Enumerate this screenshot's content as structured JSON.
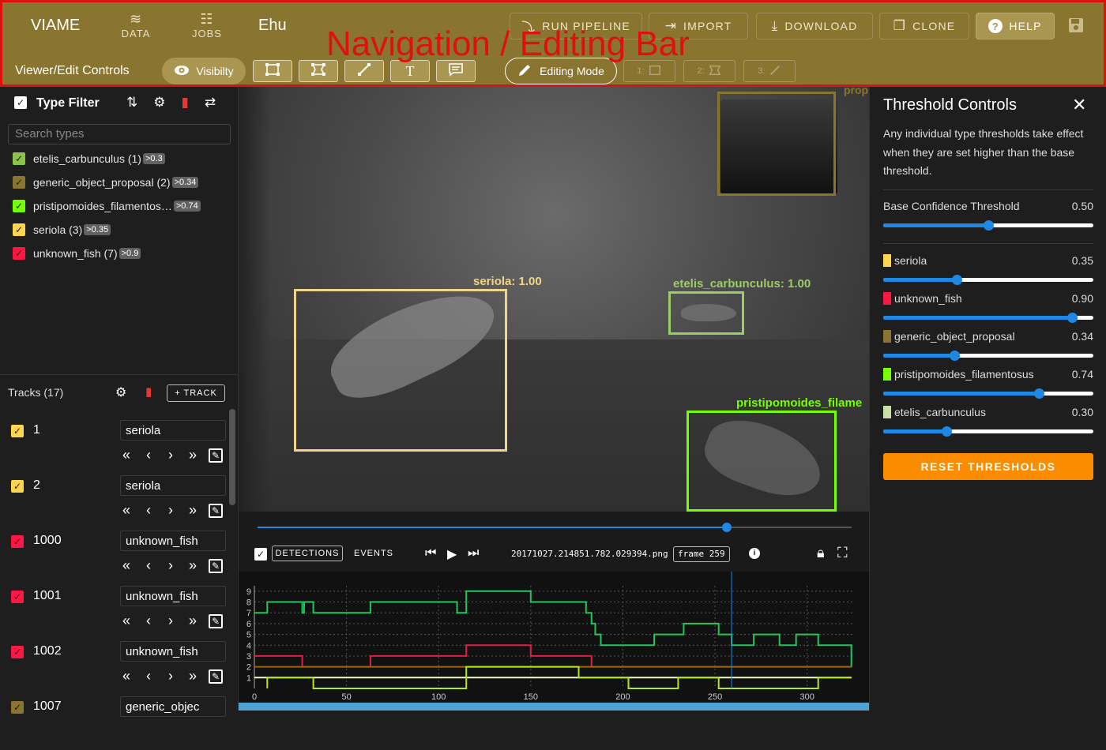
{
  "header": {
    "brand": "VIAME",
    "nav": [
      {
        "label": "DATA",
        "icon": "database-icon",
        "glyph": "≋"
      },
      {
        "label": "JOBS",
        "icon": "checklist-icon",
        "glyph": "☷"
      }
    ],
    "dataset_name": "Ehu",
    "actions": [
      {
        "label": "RUN PIPELINE",
        "icon": "pipeline-icon",
        "glyph": "⤵"
      },
      {
        "label": "IMPORT",
        "icon": "import-icon",
        "glyph": "⇥"
      },
      {
        "label": "DOWNLOAD",
        "icon": "download-icon",
        "glyph": "⤓"
      },
      {
        "label": "CLONE",
        "icon": "clone-icon",
        "glyph": "❐"
      },
      {
        "label": "HELP",
        "icon": "help-icon",
        "glyph": "?"
      }
    ],
    "subtitle": "Viewer/Edit Controls",
    "visibility_label": "Visibilty",
    "editing_mode_label": "Editing Mode",
    "overlay_annotation": "Navigation / Editing Bar",
    "text_tool_glyph": "T",
    "disabled_tools": [
      "1:",
      "2:",
      "3:"
    ],
    "accent_color": "#8a7530",
    "annotation_color": "#e01010"
  },
  "type_filter": {
    "title": "Type Filter",
    "search_placeholder": "Search types",
    "types": [
      {
        "name": "etelis_carbunculus (1)",
        "threshold": ">0.3",
        "color": "#8bc34a"
      },
      {
        "name": "generic_object_proposal (2)",
        "threshold": ">0.34",
        "color": "#8a7530"
      },
      {
        "name": "pristipomoides_filamentos…",
        "threshold": ">0.74",
        "color": "#76ff03"
      },
      {
        "name": "seriola (3)",
        "threshold": ">0.35",
        "color": "#ffd54f"
      },
      {
        "name": "unknown_fish (7)",
        "threshold": ">0.9",
        "color": "#ff1744"
      }
    ]
  },
  "tracks": {
    "title": "Tracks (17)",
    "add_label": "+ TRACK",
    "items": [
      {
        "id": "1",
        "type": "seriola",
        "color": "#ffd54f"
      },
      {
        "id": "2",
        "type": "seriola",
        "color": "#ffd54f"
      },
      {
        "id": "1000",
        "type": "unknown_fish",
        "color": "#ff1744"
      },
      {
        "id": "1001",
        "type": "unknown_fish",
        "color": "#ff1744"
      },
      {
        "id": "1002",
        "type": "unknown_fish",
        "color": "#ff1744"
      },
      {
        "id": "1007",
        "type": "generic_objec",
        "color": "#8a7530"
      }
    ]
  },
  "video": {
    "detections": [
      {
        "label": "seriola: 1.00",
        "color": "#f0d58a"
      },
      {
        "label": "etelis_carbunculus: 1.00",
        "color": "#9ccc65"
      },
      {
        "label": "pristipomoides_filame",
        "color": "#76ff03"
      },
      {
        "label": "prop",
        "color": "#8a7530"
      }
    ]
  },
  "controls": {
    "detections_label": "DETECTIONS",
    "events_label": "EVENTS",
    "filename": "20171027.214851.782.029394.png",
    "frame_label": "frame 259",
    "progress": 0.79
  },
  "chart_data": {
    "type": "line",
    "x_ticks": [
      0,
      50,
      100,
      150,
      200,
      250,
      300
    ],
    "y_ticks": [
      1,
      2,
      3,
      4,
      5,
      6,
      7,
      8,
      9
    ],
    "xlim": [
      0,
      325
    ],
    "ylim": [
      0,
      9.5
    ],
    "current_frame": 259,
    "grid": true,
    "series": [
      {
        "color": "#22c55e",
        "points": [
          [
            0,
            7
          ],
          [
            7,
            7
          ],
          [
            7,
            8
          ],
          [
            26,
            8
          ],
          [
            26,
            7
          ],
          [
            27,
            7
          ],
          [
            27,
            8
          ],
          [
            32,
            8
          ],
          [
            32,
            7
          ],
          [
            63,
            7
          ],
          [
            63,
            8
          ],
          [
            110,
            8
          ],
          [
            110,
            7
          ],
          [
            115,
            7
          ],
          [
            115,
            9
          ],
          [
            150,
            9
          ],
          [
            150,
            8
          ],
          [
            180,
            8
          ],
          [
            180,
            7
          ],
          [
            183,
            7
          ],
          [
            183,
            6
          ],
          [
            185,
            6
          ],
          [
            185,
            5
          ],
          [
            188,
            5
          ],
          [
            188,
            4
          ],
          [
            217,
            4
          ],
          [
            217,
            5
          ],
          [
            233,
            5
          ],
          [
            233,
            6
          ],
          [
            252,
            6
          ],
          [
            252,
            5
          ],
          [
            259,
            5
          ],
          [
            259,
            4
          ],
          [
            271,
            4
          ],
          [
            271,
            5
          ],
          [
            285,
            5
          ],
          [
            285,
            4
          ],
          [
            294,
            4
          ],
          [
            294,
            5
          ],
          [
            306,
            5
          ],
          [
            306,
            4
          ],
          [
            324,
            4
          ],
          [
            324,
            2
          ]
        ]
      },
      {
        "color": "#e11d48",
        "points": [
          [
            0,
            3
          ],
          [
            26,
            3
          ],
          [
            26,
            2
          ],
          [
            63,
            2
          ],
          [
            63,
            3
          ],
          [
            115,
            3
          ],
          [
            115,
            4
          ],
          [
            150,
            4
          ],
          [
            150,
            3
          ],
          [
            183,
            3
          ],
          [
            183,
            2
          ],
          [
            324,
            2
          ]
        ]
      },
      {
        "color": "#a16207",
        "points": [
          [
            0,
            2
          ],
          [
            324,
            2
          ]
        ]
      },
      {
        "color": "#ecfccb",
        "points": [
          [
            0,
            1
          ],
          [
            324,
            1
          ]
        ]
      },
      {
        "color": "#b5e61d",
        "points": [
          [
            7,
            0
          ],
          [
            7,
            1
          ],
          [
            32,
            1
          ],
          [
            32,
            0
          ],
          [
            115,
            0
          ],
          [
            115,
            2
          ],
          [
            176,
            2
          ],
          [
            176,
            1
          ],
          [
            203,
            1
          ],
          [
            203,
            0
          ],
          [
            230,
            0
          ],
          [
            230,
            1
          ],
          [
            252,
            1
          ],
          [
            252,
            0
          ],
          [
            306,
            0
          ],
          [
            306,
            1
          ],
          [
            324,
            1
          ]
        ]
      }
    ]
  },
  "thresholds": {
    "title": "Threshold Controls",
    "description": "Any individual type thresholds take effect when they are set higher than the base threshold.",
    "base_label": "Base Confidence Threshold",
    "base_value": "0.50",
    "base_level": 0.5,
    "types": [
      {
        "name": "seriola",
        "value": "0.35",
        "level": 0.35,
        "color": "#ffd54f"
      },
      {
        "name": "unknown_fish",
        "value": "0.90",
        "level": 0.9,
        "color": "#ff1744"
      },
      {
        "name": "generic_object_proposal",
        "value": "0.34",
        "level": 0.34,
        "color": "#8a7530"
      },
      {
        "name": "pristipomoides_filamentosus",
        "value": "0.74",
        "level": 0.74,
        "color": "#76ff03"
      },
      {
        "name": "etelis_carbunculus",
        "value": "0.30",
        "level": 0.3,
        "color": "#c5e1a5"
      }
    ],
    "reset_label": "RESET THRESHOLDS"
  }
}
